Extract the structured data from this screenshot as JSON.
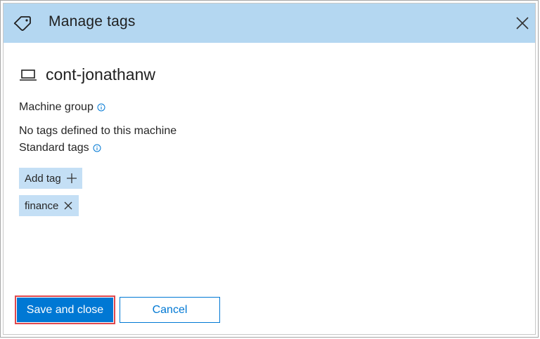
{
  "dialog": {
    "title": "Manage tags",
    "header_icon": "tag-icon",
    "close_icon": "close-icon"
  },
  "machine": {
    "icon": "laptop-icon",
    "name": "cont-jonathanw"
  },
  "machine_group": {
    "label": "Machine group",
    "info_icon": "info-icon"
  },
  "no_tags_text": "No tags defined to this machine",
  "standard_tags": {
    "label": "Standard tags",
    "info_icon": "info-icon"
  },
  "add_tag": {
    "label": "Add tag",
    "icon": "plus-icon"
  },
  "tags": [
    {
      "label": "finance",
      "remove_icon": "close-icon"
    }
  ],
  "footer": {
    "save_label": "Save and close",
    "cancel_label": "Cancel"
  },
  "colors": {
    "header_bg": "#b4d7f1",
    "chip_bg": "#c4dff5",
    "accent": "#0078d4",
    "highlight_border": "#e0474c"
  }
}
